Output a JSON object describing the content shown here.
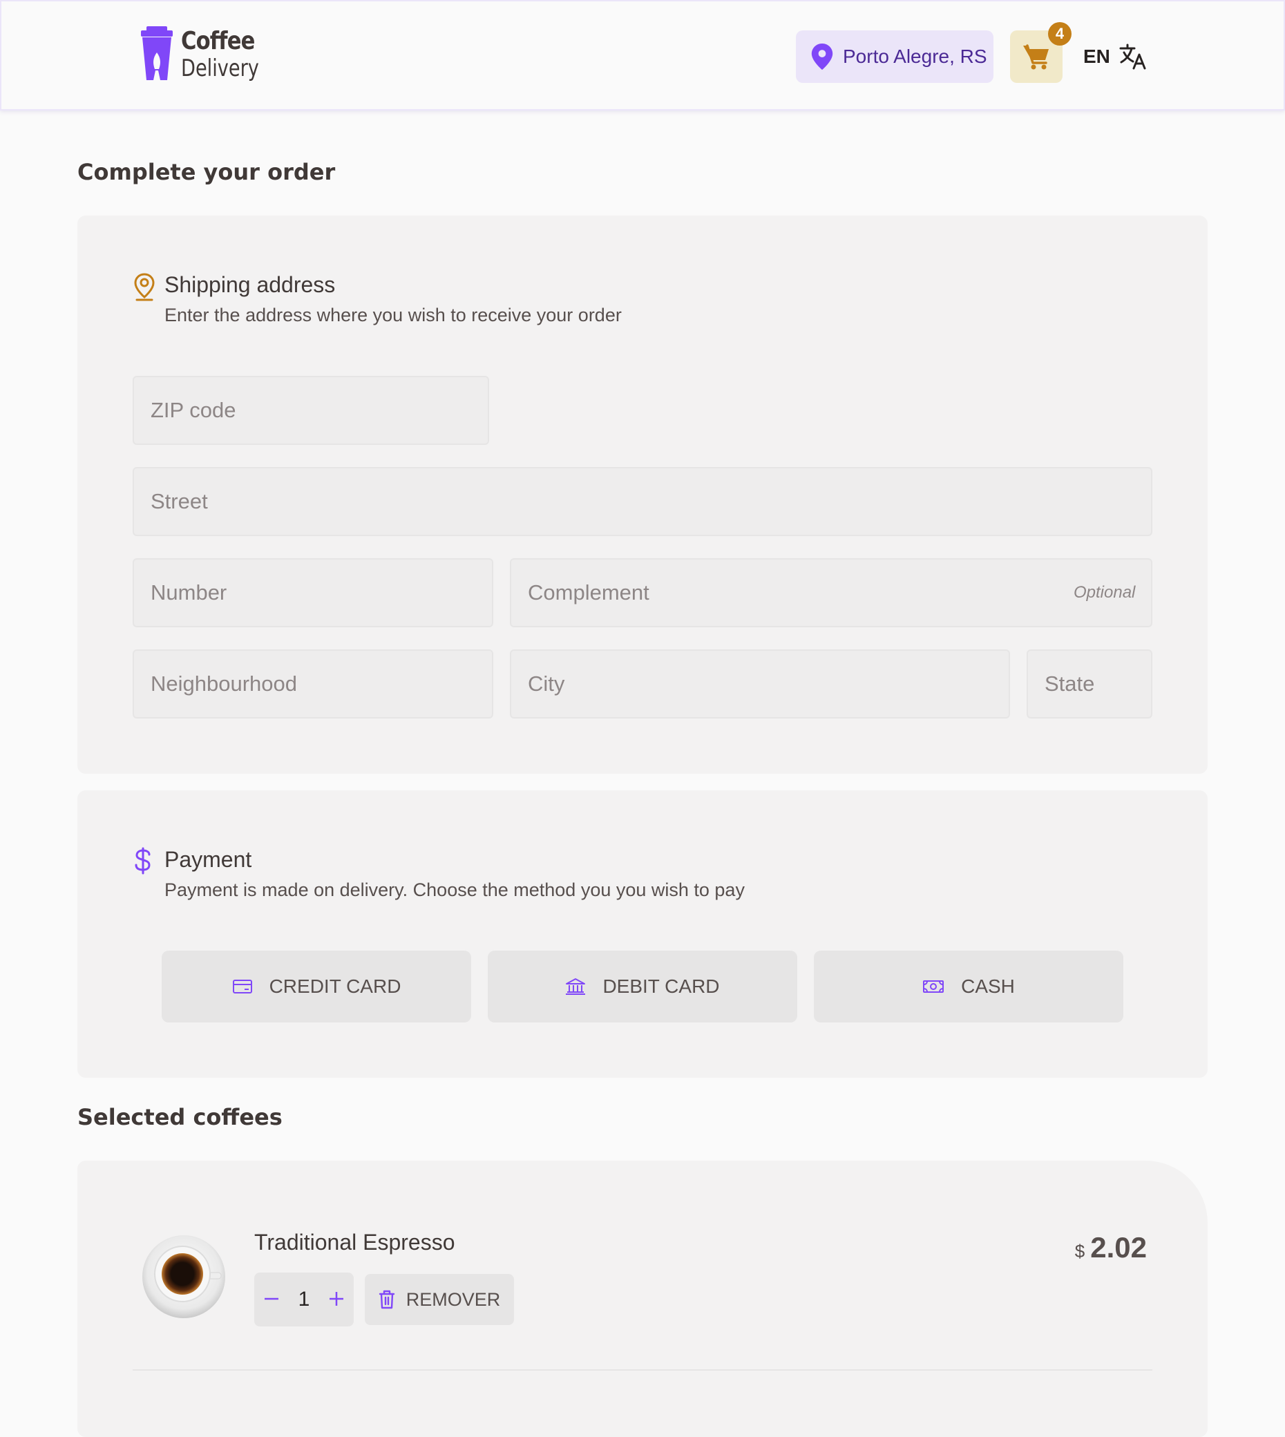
{
  "header": {
    "logo": {
      "line1": "Coffee",
      "line2": "Delivery"
    },
    "location": "Porto Alegre, RS",
    "cart_count": "4",
    "language": "EN"
  },
  "order": {
    "title": "Complete your order",
    "shipping": {
      "title": "Shipping address",
      "subtitle": "Enter the address where you wish to receive your order",
      "fields": {
        "zip": {
          "placeholder": "ZIP code",
          "value": ""
        },
        "street": {
          "placeholder": "Street",
          "value": ""
        },
        "number": {
          "placeholder": "Number",
          "value": ""
        },
        "complement": {
          "placeholder": "Complement",
          "value": "",
          "hint": "Optional"
        },
        "neighbourhood": {
          "placeholder": "Neighbourhood",
          "value": ""
        },
        "city": {
          "placeholder": "City",
          "value": ""
        },
        "state": {
          "placeholder": "State",
          "value": ""
        }
      }
    },
    "payment": {
      "title": "Payment",
      "subtitle": "Payment is made on delivery. Choose the method you you wish to pay",
      "methods": [
        {
          "label": "CREDIT CARD",
          "icon": "credit-card-icon"
        },
        {
          "label": "DEBIT CARD",
          "icon": "bank-icon"
        },
        {
          "label": "CASH",
          "icon": "money-icon"
        }
      ]
    }
  },
  "selected": {
    "title": "Selected coffees",
    "items": [
      {
        "name": "Traditional Espresso",
        "quantity": "1",
        "remove_label": "REMOVER",
        "currency": "$",
        "price": "2.02",
        "image": "espresso-cup"
      }
    ]
  },
  "colors": {
    "purple": "#8047f8",
    "purple_dark": "#4b2995",
    "purple_light": "#ebe5f9",
    "yellow": "#dbac2c",
    "yellow_dark": "#c47f17",
    "yellow_light": "#f1e9c9",
    "card_bg": "#f3f2f2"
  }
}
